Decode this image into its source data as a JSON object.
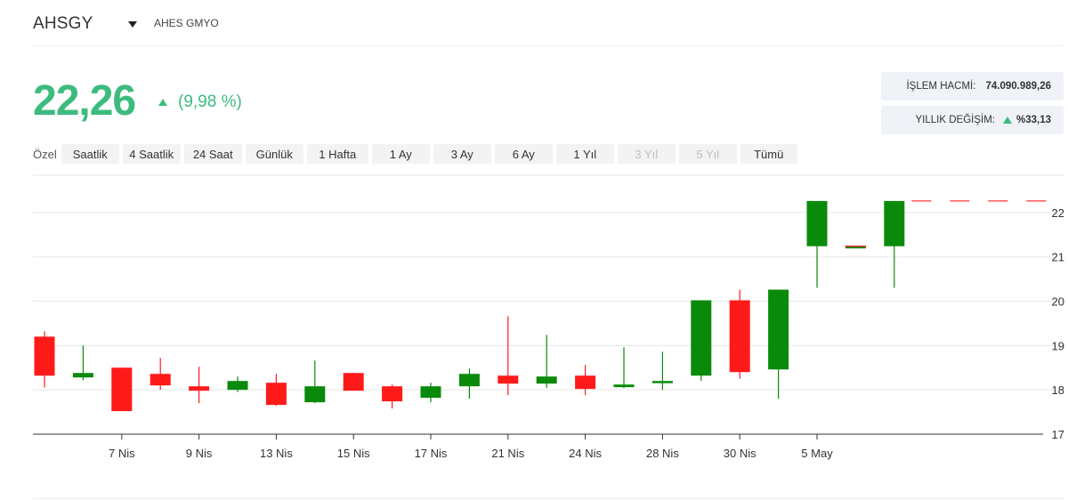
{
  "header": {
    "ticker": "AHSGY",
    "dropdown_icon": "caret-down-icon",
    "company": "AHES GMYO"
  },
  "quote": {
    "price": "22,26",
    "change_icon": "triangle-up-icon",
    "change": "(9,98 %)",
    "up_color": "#3dbb7e"
  },
  "stats": {
    "volume_label": "İŞLEM HACMİ:",
    "volume_value": "74.090.989,26",
    "yearly_label": "YILLIK DEĞİŞİM:",
    "yearly_icon": "triangle-up-icon",
    "yearly_value": "%33,13"
  },
  "ranges": {
    "label": "Özel",
    "buttons": [
      {
        "label": "Saatlik",
        "disabled": false
      },
      {
        "label": "4 Saatlik",
        "disabled": false
      },
      {
        "label": "24 Saat",
        "disabled": false
      },
      {
        "label": "Günlük",
        "disabled": false
      },
      {
        "label": "1 Hafta",
        "disabled": false
      },
      {
        "label": "1 Ay",
        "disabled": false
      },
      {
        "label": "3 Ay",
        "disabled": false
      },
      {
        "label": "6 Ay",
        "disabled": false
      },
      {
        "label": "1 Yıl",
        "disabled": false
      },
      {
        "label": "3 Yıl",
        "disabled": true
      },
      {
        "label": "5 Yıl",
        "disabled": true
      },
      {
        "label": "Tümü",
        "disabled": false
      }
    ]
  },
  "chart_data": {
    "type": "candlestick",
    "up_color": "#0a8a0a",
    "down_color": "#ff1a1a",
    "ylim": [
      17,
      22.8
    ],
    "yticks": [
      17,
      18,
      19,
      20,
      21,
      22
    ],
    "xticks": [
      {
        "index": 2,
        "label": "7 Nis"
      },
      {
        "index": 4,
        "label": "9 Nis"
      },
      {
        "index": 6,
        "label": "13 Nis"
      },
      {
        "index": 8,
        "label": "15 Nis"
      },
      {
        "index": 10,
        "label": "17 Nis"
      },
      {
        "index": 12,
        "label": "21 Nis"
      },
      {
        "index": 14,
        "label": "24 Nis"
      },
      {
        "index": 16,
        "label": "28 Nis"
      },
      {
        "index": 18,
        "label": "30 Nis"
      },
      {
        "index": 20,
        "label": "5 May"
      }
    ],
    "candles": [
      {
        "o": 19.2,
        "h": 19.32,
        "l": 18.05,
        "c": 18.32
      },
      {
        "o": 18.28,
        "h": 19.0,
        "l": 18.22,
        "c": 18.38
      },
      {
        "o": 18.5,
        "h": 18.5,
        "l": 17.52,
        "c": 17.52
      },
      {
        "o": 18.36,
        "h": 18.72,
        "l": 18.0,
        "c": 18.1
      },
      {
        "o": 18.08,
        "h": 18.52,
        "l": 17.7,
        "c": 17.98
      },
      {
        "o": 18.0,
        "h": 18.3,
        "l": 17.95,
        "c": 18.2
      },
      {
        "o": 18.16,
        "h": 18.36,
        "l": 17.64,
        "c": 17.66
      },
      {
        "o": 17.72,
        "h": 18.66,
        "l": 17.7,
        "c": 18.08
      },
      {
        "o": 18.38,
        "h": 18.38,
        "l": 17.98,
        "c": 17.98
      },
      {
        "o": 18.08,
        "h": 18.12,
        "l": 17.58,
        "c": 17.74
      },
      {
        "o": 17.82,
        "h": 18.16,
        "l": 17.72,
        "c": 18.08
      },
      {
        "o": 18.08,
        "h": 18.48,
        "l": 17.8,
        "c": 18.36
      },
      {
        "o": 18.32,
        "h": 19.66,
        "l": 17.88,
        "c": 18.14
      },
      {
        "o": 18.14,
        "h": 19.24,
        "l": 18.04,
        "c": 18.3
      },
      {
        "o": 18.32,
        "h": 18.56,
        "l": 17.88,
        "c": 18.02
      },
      {
        "o": 18.06,
        "h": 18.96,
        "l": 18.04,
        "c": 18.12
      },
      {
        "o": 18.2,
        "h": 18.86,
        "l": 18.0,
        "c": 18.2
      },
      {
        "o": 18.32,
        "h": 20.02,
        "l": 18.2,
        "c": 20.02
      },
      {
        "o": 20.02,
        "h": 20.26,
        "l": 18.25,
        "c": 18.4
      },
      {
        "o": 18.46,
        "h": 20.26,
        "l": 17.8,
        "c": 20.26
      },
      {
        "o": 21.24,
        "h": 22.26,
        "l": 20.3,
        "c": 22.26
      },
      {
        "o": 21.24,
        "h": 21.24,
        "l": 21.24,
        "c": 21.24
      },
      {
        "o": 21.24,
        "h": 22.26,
        "l": 20.3,
        "c": 22.26
      }
    ],
    "last_price": 22.26,
    "last_price_color": "#ff3333"
  }
}
